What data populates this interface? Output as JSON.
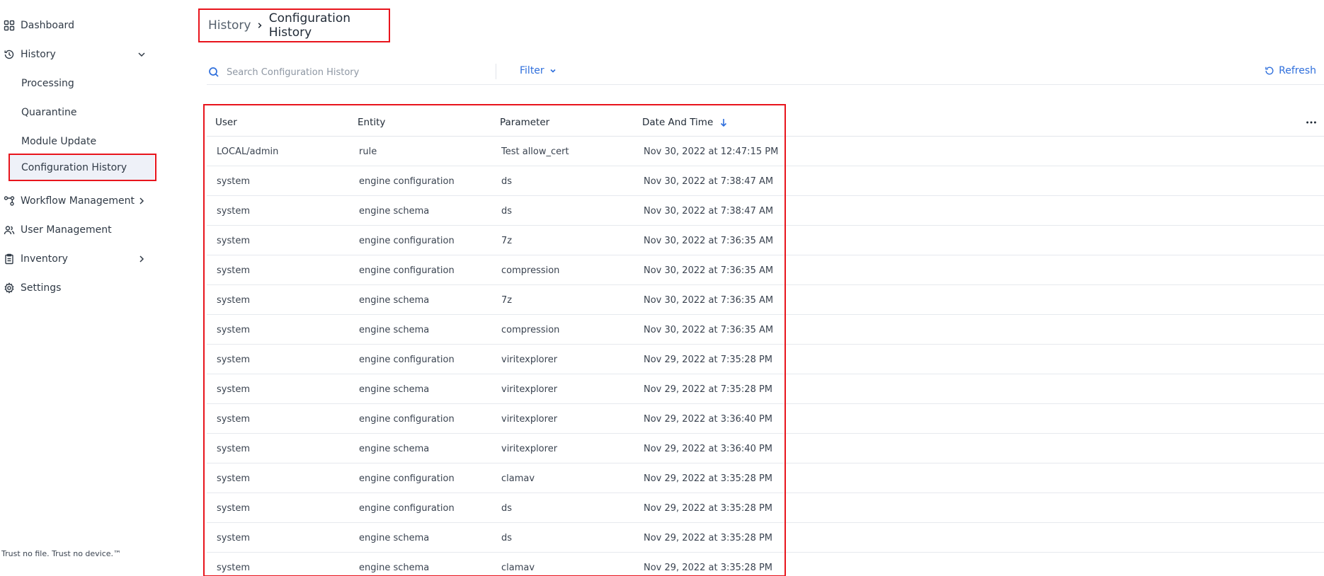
{
  "sidebar": {
    "items": [
      {
        "label": "Dashboard",
        "icon": "grid-icon"
      },
      {
        "label": "History",
        "icon": "history-icon",
        "expanded": true
      },
      {
        "label": "Workflow Management",
        "icon": "workflow-icon"
      },
      {
        "label": "User Management",
        "icon": "users-icon"
      },
      {
        "label": "Inventory",
        "icon": "clipboard-icon"
      },
      {
        "label": "Settings",
        "icon": "gear-icon"
      }
    ],
    "history_sub": [
      {
        "label": "Processing"
      },
      {
        "label": "Quarantine"
      },
      {
        "label": "Module Update"
      },
      {
        "label": "Configuration History",
        "active": true
      }
    ],
    "footer": "Trust no file. Trust no device.™"
  },
  "breadcrumb": {
    "parent": "History",
    "current": "Configuration History"
  },
  "toolbar": {
    "search_placeholder": "Search Configuration History",
    "filter_label": "Filter",
    "refresh_label": "Refresh"
  },
  "table": {
    "columns": [
      "User",
      "Entity",
      "Parameter",
      "Date And Time"
    ],
    "sort_column": "Date And Time",
    "sort_direction": "descending",
    "rows": [
      [
        "LOCAL/admin",
        "rule",
        "Test allow_cert",
        "Nov 30, 2022 at 12:47:15 PM"
      ],
      [
        "system",
        "engine configuration",
        "ds",
        "Nov 30, 2022 at 7:38:47 AM"
      ],
      [
        "system",
        "engine schema",
        "ds",
        "Nov 30, 2022 at 7:38:47 AM"
      ],
      [
        "system",
        "engine configuration",
        "7z",
        "Nov 30, 2022 at 7:36:35 AM"
      ],
      [
        "system",
        "engine configuration",
        "compression",
        "Nov 30, 2022 at 7:36:35 AM"
      ],
      [
        "system",
        "engine schema",
        "7z",
        "Nov 30, 2022 at 7:36:35 AM"
      ],
      [
        "system",
        "engine schema",
        "compression",
        "Nov 30, 2022 at 7:36:35 AM"
      ],
      [
        "system",
        "engine configuration",
        "viritexplorer",
        "Nov 29, 2022 at 7:35:28 PM"
      ],
      [
        "system",
        "engine schema",
        "viritexplorer",
        "Nov 29, 2022 at 7:35:28 PM"
      ],
      [
        "system",
        "engine configuration",
        "viritexplorer",
        "Nov 29, 2022 at 3:36:40 PM"
      ],
      [
        "system",
        "engine schema",
        "viritexplorer",
        "Nov 29, 2022 at 3:36:40 PM"
      ],
      [
        "system",
        "engine configuration",
        "clamav",
        "Nov 29, 2022 at 3:35:28 PM"
      ],
      [
        "system",
        "engine configuration",
        "ds",
        "Nov 29, 2022 at 3:35:28 PM"
      ],
      [
        "system",
        "engine schema",
        "ds",
        "Nov 29, 2022 at 3:35:28 PM"
      ],
      [
        "system",
        "engine schema",
        "clamav",
        "Nov 29, 2022 at 3:35:28 PM"
      ]
    ]
  },
  "colors": {
    "accent": "#2f6fdc",
    "highlight": "#e8141c",
    "active_bg": "#eef1f8"
  }
}
